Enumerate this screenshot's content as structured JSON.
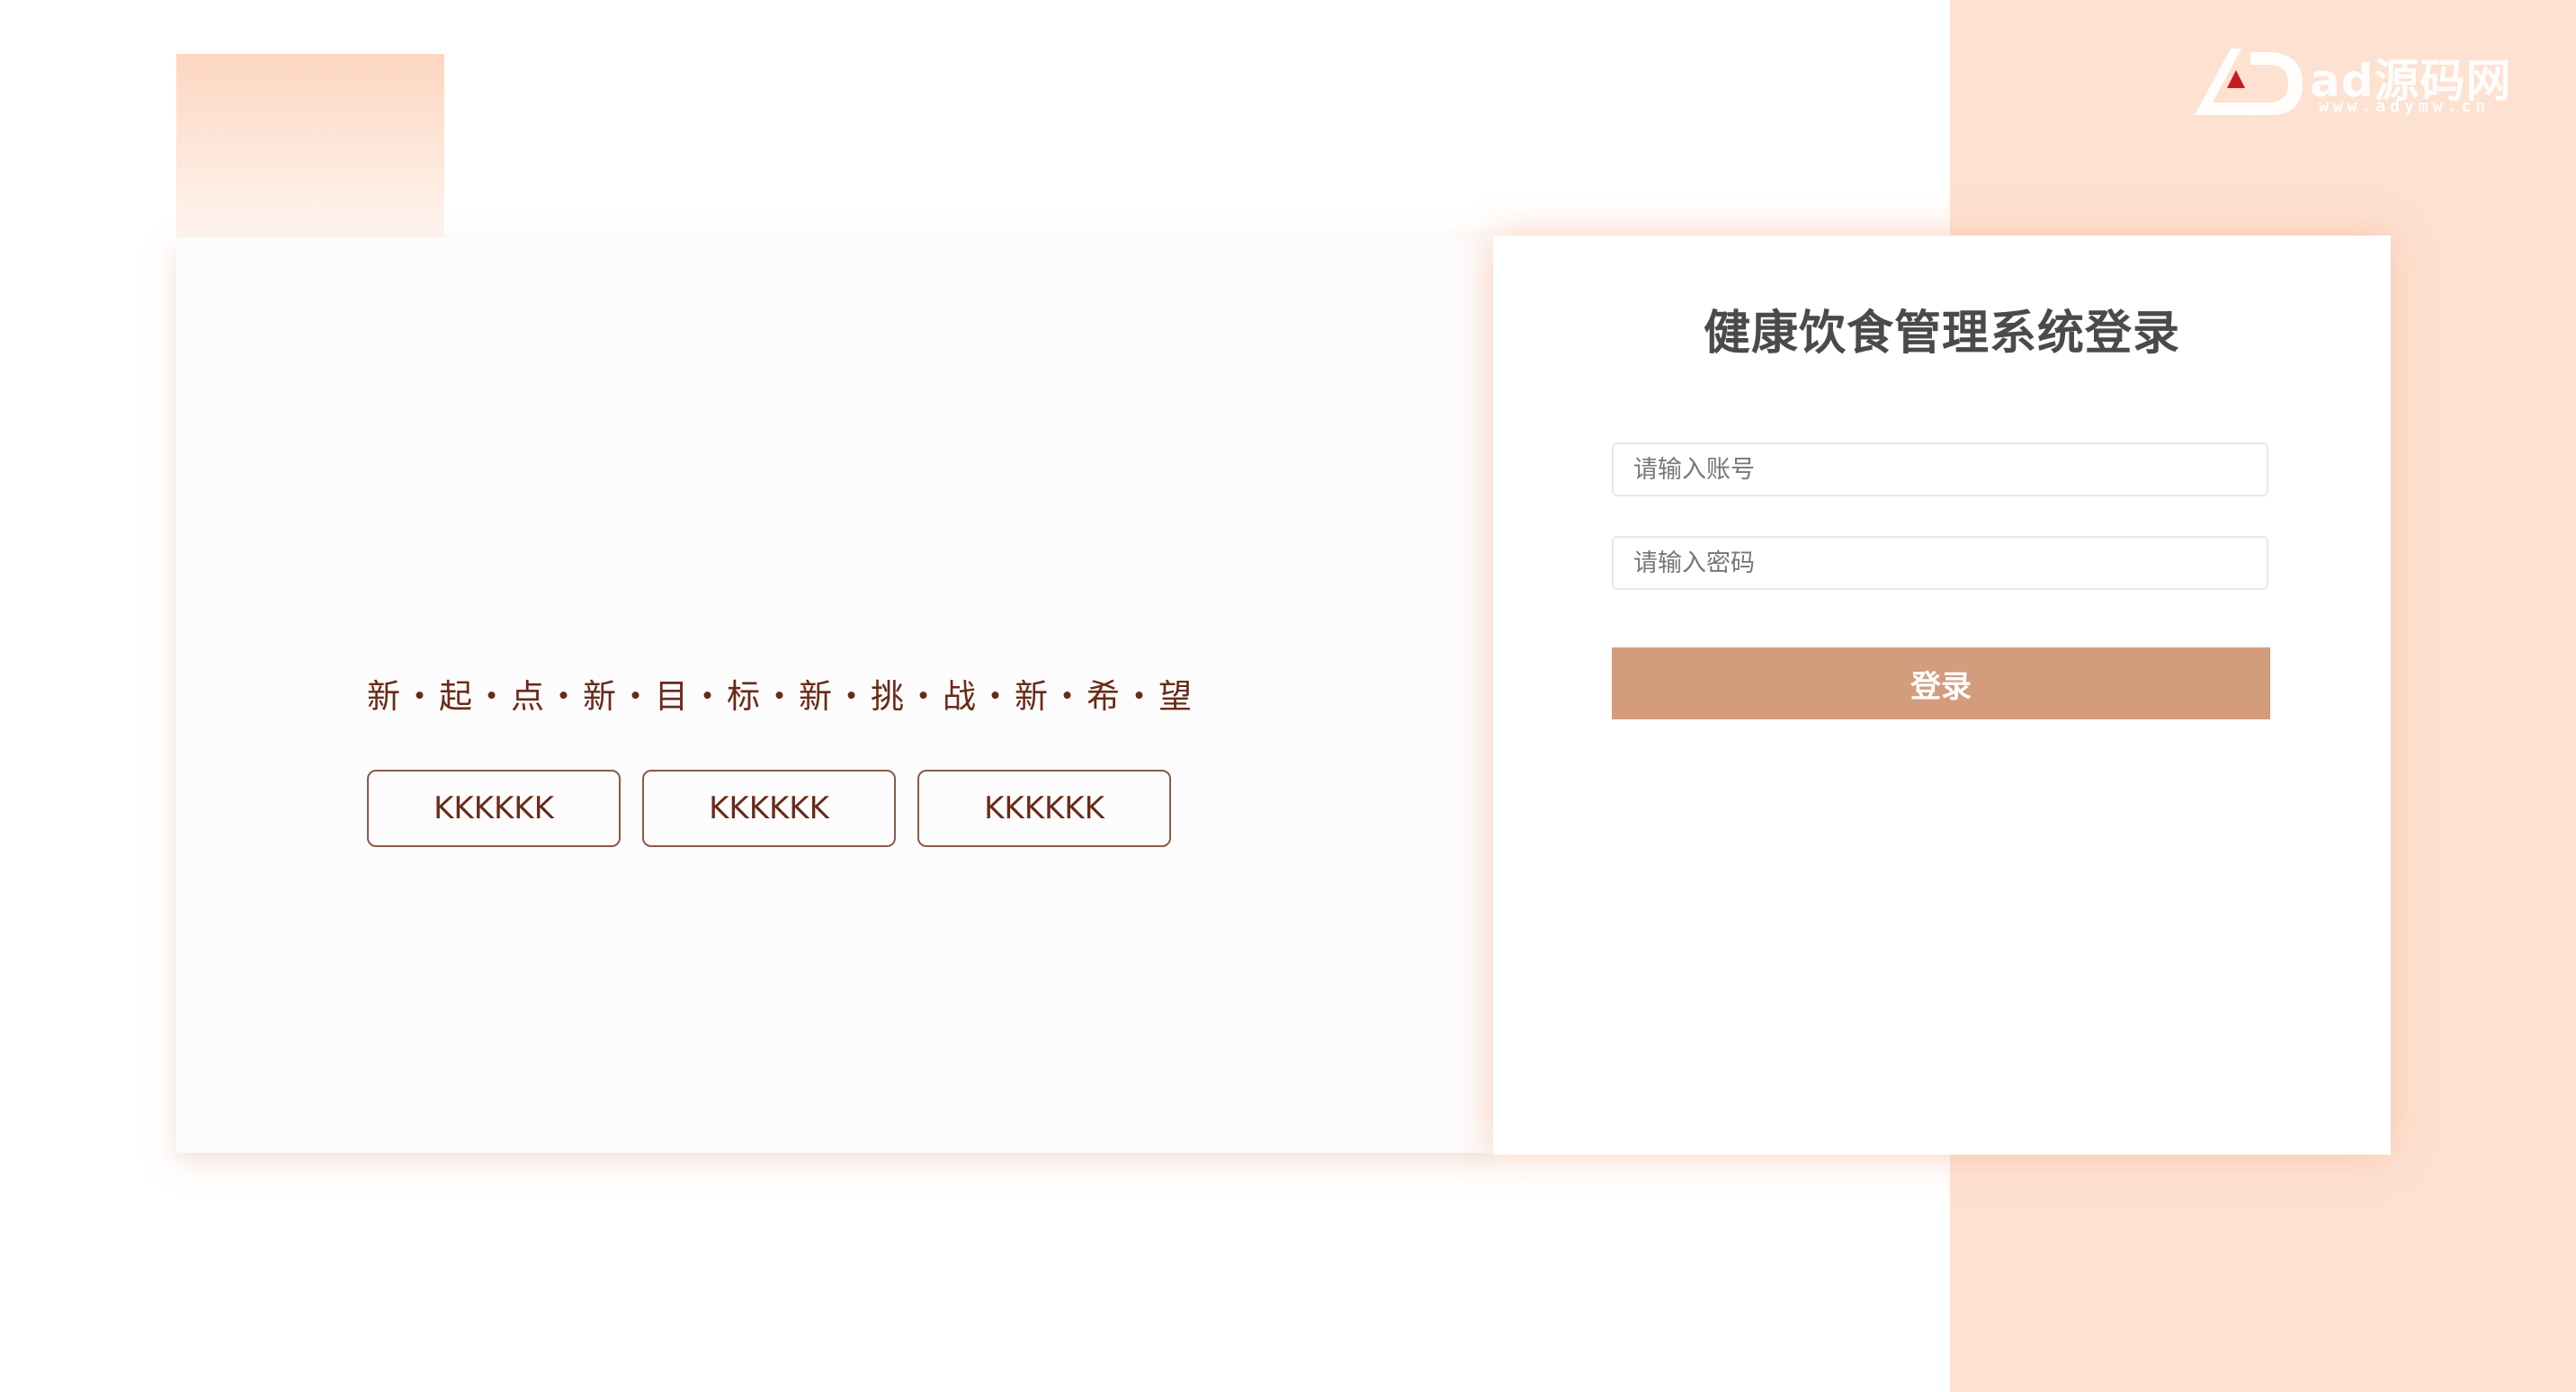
{
  "watermark": {
    "brand_text": "ad源码网",
    "brand_url": "www.adymw.cn"
  },
  "hero": {
    "slogan": "新・起・点・新・目・标・新・挑・战・新・希・望",
    "pills": [
      {
        "label": "KKKKKK"
      },
      {
        "label": "KKKKKK"
      },
      {
        "label": "KKKKKK"
      }
    ]
  },
  "login": {
    "title": "健康饮食管理系统登录",
    "username_placeholder": "请输入账号",
    "password_placeholder": "请输入密码",
    "submit_label": "登录"
  },
  "colors": {
    "accent": "#d29c7d",
    "right_background": "#fde1d1",
    "slogan_text": "#6a2a18",
    "title_text": "#4a4a4a"
  }
}
